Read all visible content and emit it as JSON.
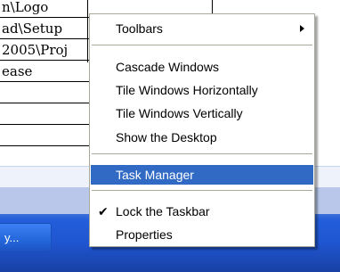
{
  "document": {
    "rows": [
      "n\\Logo",
      "ad\\Setup",
      "2005\\Proj",
      "ease",
      "",
      "",
      ""
    ]
  },
  "taskbar": {
    "button_label": "y..."
  },
  "context_menu": {
    "items": [
      {
        "label": "Toolbars",
        "submenu": true
      },
      {
        "label": "Cascade Windows"
      },
      {
        "label": "Tile Windows Horizontally"
      },
      {
        "label": "Tile Windows Vertically"
      },
      {
        "label": "Show the Desktop"
      },
      {
        "label": "Task Manager",
        "selected": true
      },
      {
        "label": "Lock the Taskbar",
        "checked": true
      },
      {
        "label": "Properties"
      }
    ],
    "check_glyph": "✔"
  },
  "colors": {
    "selection": "#316ac5",
    "taskbar": "#245edb",
    "menu_border": "#aca899"
  }
}
